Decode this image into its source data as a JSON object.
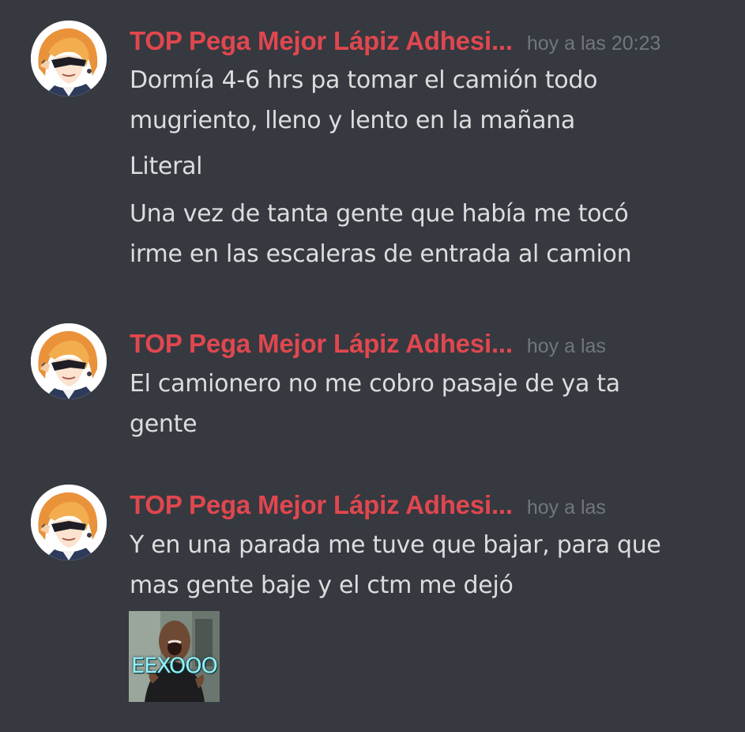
{
  "theme": {
    "background": "#36393f",
    "username_color": "#e0474f",
    "timestamp_color": "#72767d",
    "text_color": "#dcddde"
  },
  "messages": [
    {
      "author": "TOP Pega Mejor Lápiz Adhesi...",
      "timestamp": "hoy a las 20:23",
      "avatar_icon": "anime-avatar-sunglasses-icon",
      "lines": [
        "Dormía 4-6 hrs pa tomar el camión todo",
        "mugriento, lleno y lento en la mañana",
        "Literal",
        "Una vez de tanta gente que había me tocó",
        "irme en las escaleras de entrada al camion"
      ]
    },
    {
      "author": "TOP Pega Mejor Lápiz Adhesi...",
      "timestamp": "hoy a las",
      "avatar_icon": "anime-avatar-sunglasses-icon",
      "lines": [
        "El camionero no me cobro pasaje de ya ta",
        "gente"
      ]
    },
    {
      "author": "TOP Pega Mejor Lápiz Adhesi...",
      "timestamp": "hoy a las",
      "avatar_icon": "anime-avatar-sunglasses-icon",
      "lines": [
        "Y en una parada me tuve que bajar, para que",
        "mas gente baje y el ctm me dejó"
      ],
      "attachment": {
        "type": "gif",
        "caption": "EEXOOO"
      }
    }
  ]
}
